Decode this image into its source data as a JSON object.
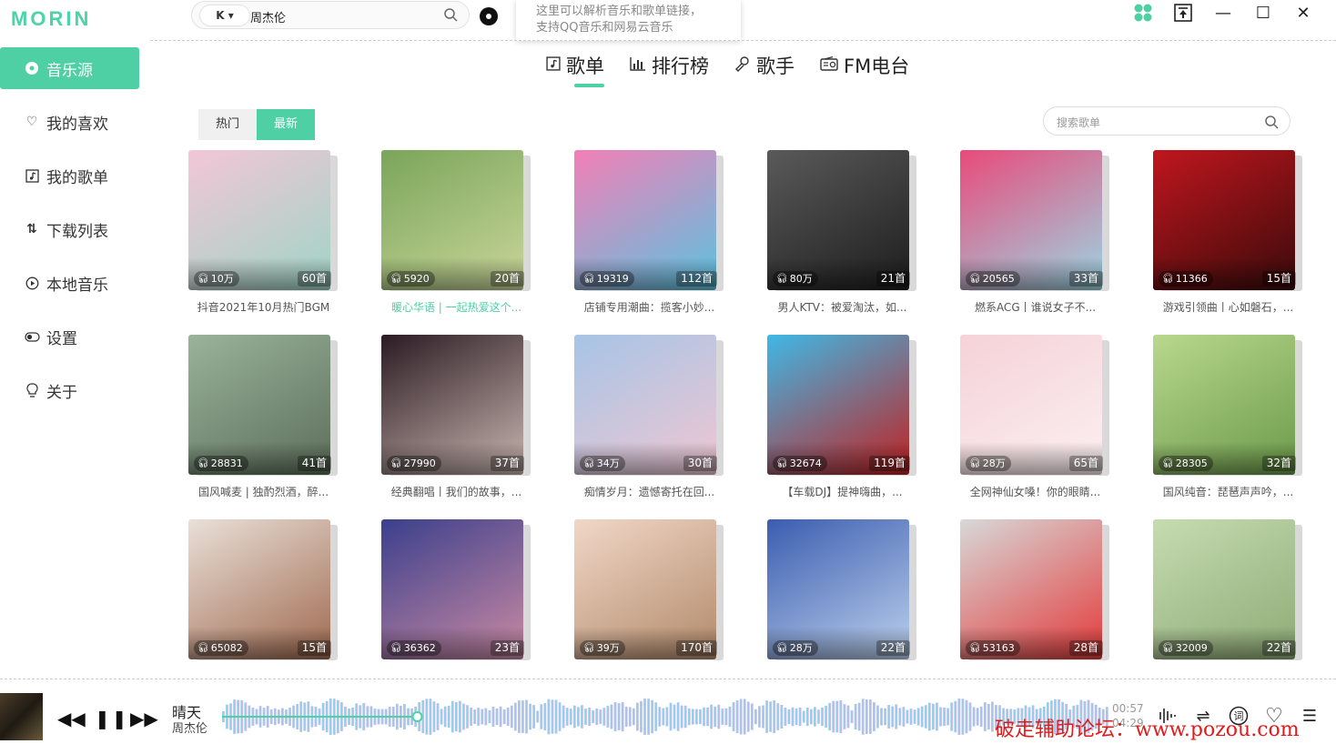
{
  "app": {
    "logo": "MORIN"
  },
  "search": {
    "source": "K",
    "value": "周杰伦"
  },
  "tooltip": {
    "line1": "这里可以解析音乐和歌单链接，",
    "line2": "支持QQ音乐和网易云音乐"
  },
  "sidebar": {
    "items": [
      {
        "label": "音乐源",
        "icon": "music-source-icon",
        "active": true
      },
      {
        "label": "我的喜欢",
        "icon": "heart-icon",
        "active": false
      },
      {
        "label": "我的歌单",
        "icon": "playlist-icon",
        "active": false
      },
      {
        "label": "下载列表",
        "icon": "download-icon",
        "active": false
      },
      {
        "label": "本地音乐",
        "icon": "play-circle-icon",
        "active": false
      },
      {
        "label": "设置",
        "icon": "toggle-icon",
        "active": false
      },
      {
        "label": "关于",
        "icon": "bulb-icon",
        "active": false
      }
    ]
  },
  "tabs": [
    {
      "label": "歌单",
      "active": true
    },
    {
      "label": "排行榜",
      "active": false
    },
    {
      "label": "歌手",
      "active": false
    },
    {
      "label": "FM电台",
      "active": false
    }
  ],
  "filters": [
    {
      "label": "热门",
      "on": false
    },
    {
      "label": "最新",
      "on": true
    }
  ],
  "list_search": {
    "placeholder": "搜索歌单"
  },
  "playlists": [
    {
      "plays": "10万",
      "songs": "60首",
      "title": "抖音2021年10月热门BGM",
      "highlight": false,
      "c1": "#f3c6d6",
      "c2": "#9fd4c6"
    },
    {
      "plays": "5920",
      "songs": "20首",
      "title": "暖心华语 | 一起热爱这个...",
      "highlight": true,
      "c1": "#7aa55a",
      "c2": "#c9d69a"
    },
    {
      "plays": "19319",
      "songs": "112首",
      "title": "店铺专用潮曲：揽客小妙...",
      "highlight": false,
      "c1": "#f37fb6",
      "c2": "#5bc3e0"
    },
    {
      "plays": "80万",
      "songs": "21首",
      "title": "男人KTV：被爱淘汰，如...",
      "highlight": false,
      "c1": "#5a5a5a",
      "c2": "#1d1d1d"
    },
    {
      "plays": "20565",
      "songs": "33首",
      "title": "燃系ACG丨谁说女子不...",
      "highlight": false,
      "c1": "#e94a7a",
      "c2": "#9bd6e3"
    },
    {
      "plays": "11366",
      "songs": "15首",
      "title": "游戏引领曲丨心如磐石，...",
      "highlight": false,
      "c1": "#c0161e",
      "c2": "#3a0a0a"
    },
    {
      "plays": "28831",
      "songs": "41首",
      "title": "国风喊麦 | 独酌烈酒，醉...",
      "highlight": false,
      "c1": "#9ab39a",
      "c2": "#5c6e5a"
    },
    {
      "plays": "27990",
      "songs": "37首",
      "title": "经典翻唱丨我们的故事，...",
      "highlight": false,
      "c1": "#2b1a22",
      "c2": "#c8b6b0"
    },
    {
      "plays": "34万",
      "songs": "30首",
      "title": "痴情岁月：遗憾寄托在回...",
      "highlight": false,
      "c1": "#a7c4e6",
      "c2": "#eec7d2"
    },
    {
      "plays": "32674",
      "songs": "119首",
      "title": "【车载DJ】提神嗨曲，...",
      "highlight": false,
      "c1": "#3fb8e6",
      "c2": "#c02222"
    },
    {
      "plays": "28万",
      "songs": "65首",
      "title": "全网神仙女嗓！你的眼睛...",
      "highlight": false,
      "c1": "#f5d2d8",
      "c2": "#fbeff0"
    },
    {
      "plays": "28305",
      "songs": "32首",
      "title": "国风纯音：琵琶声声吟，...",
      "highlight": false,
      "c1": "#b8d88e",
      "c2": "#6c9a4a"
    },
    {
      "plays": "65082",
      "songs": "15首",
      "title": "",
      "highlight": false,
      "c1": "#e9e0d8",
      "c2": "#a06a50"
    },
    {
      "plays": "36362",
      "songs": "23首",
      "title": "",
      "highlight": false,
      "c1": "#3b3f8c",
      "c2": "#c98aa3"
    },
    {
      "plays": "39万",
      "songs": "170首",
      "title": "",
      "highlight": false,
      "c1": "#f1d7c8",
      "c2": "#b28a6a"
    },
    {
      "plays": "28万",
      "songs": "22首",
      "title": "",
      "highlight": false,
      "c1": "#3b5db0",
      "c2": "#bcd0ec"
    },
    {
      "plays": "53163",
      "songs": "28首",
      "title": "",
      "highlight": false,
      "c1": "#d8d8d8",
      "c2": "#e33b3b"
    },
    {
      "plays": "32009",
      "songs": "22首",
      "title": "",
      "highlight": false,
      "c1": "#c5dcb1",
      "c2": "#8faa76"
    }
  ],
  "player": {
    "title": "晴天",
    "artist": "周杰伦",
    "current_time": "00:57",
    "total_time": "04:29",
    "progress": 0.22
  },
  "watermark": "破走辅助论坛：www.pozou.com"
}
